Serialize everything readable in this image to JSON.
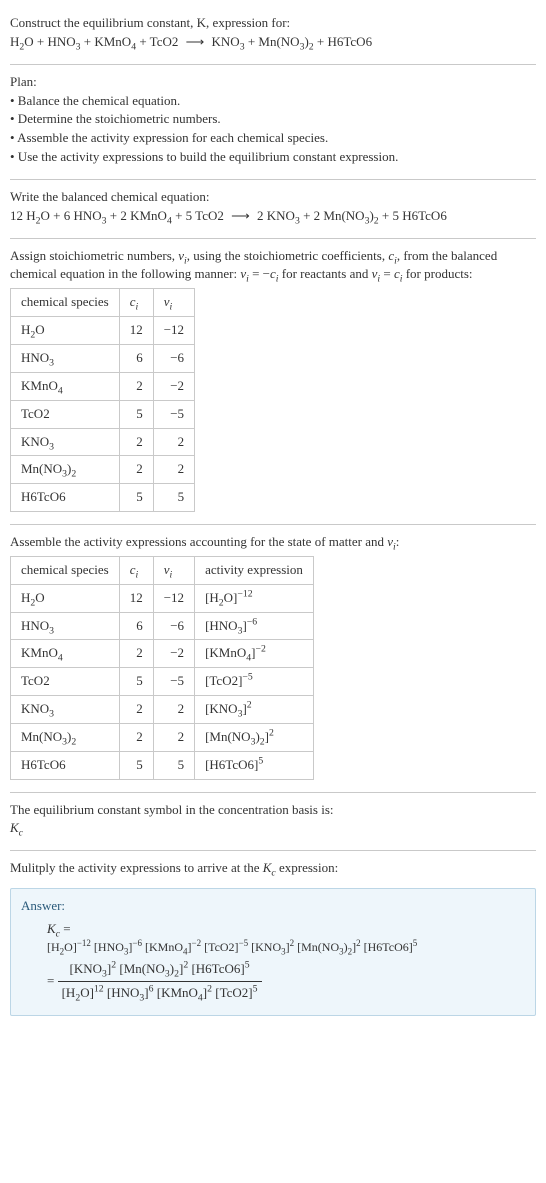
{
  "header": {
    "line1": "Construct the equilibrium constant, K, expression for:",
    "equation": "H₂O + HNO₃ + KMnO₄ + TcO2 ⟶ KNO₃ + Mn(NO₃)₂ + H6TcO6"
  },
  "plan": {
    "title": "Plan:",
    "items": [
      "• Balance the chemical equation.",
      "• Determine the stoichiometric numbers.",
      "• Assemble the activity expression for each chemical species.",
      "• Use the activity expressions to build the equilibrium constant expression."
    ]
  },
  "balanced": {
    "title": "Write the balanced chemical equation:",
    "equation": "12 H₂O + 6 HNO₃ + 2 KMnO₄ + 5 TcO2 ⟶ 2 KNO₃ + 2 Mn(NO₃)₂ + 5 H6TcO6"
  },
  "assign": {
    "title_prefix": "Assign stoichiometric numbers, νᵢ, using the stoichiometric coefficients, cᵢ, from the balanced chemical equation in the following manner: νᵢ = −cᵢ for reactants and νᵢ = cᵢ for products:"
  },
  "table1": {
    "headers": [
      "chemical species",
      "cᵢ",
      "νᵢ"
    ],
    "rows": [
      {
        "species": "H₂O",
        "c": "12",
        "v": "−12"
      },
      {
        "species": "HNO₃",
        "c": "6",
        "v": "−6"
      },
      {
        "species": "KMnO₄",
        "c": "2",
        "v": "−2"
      },
      {
        "species": "TcO2",
        "c": "5",
        "v": "−5"
      },
      {
        "species": "KNO₃",
        "c": "2",
        "v": "2"
      },
      {
        "species": "Mn(NO₃)₂",
        "c": "2",
        "v": "2"
      },
      {
        "species": "H6TcO6",
        "c": "5",
        "v": "5"
      }
    ]
  },
  "activity_intro": "Assemble the activity expressions accounting for the state of matter and νᵢ:",
  "table2": {
    "headers": [
      "chemical species",
      "cᵢ",
      "νᵢ",
      "activity expression"
    ],
    "rows": [
      {
        "species": "H₂O",
        "c": "12",
        "v": "−12",
        "act_base": "[H₂O]",
        "act_exp": "−12"
      },
      {
        "species": "HNO₃",
        "c": "6",
        "v": "−6",
        "act_base": "[HNO₃]",
        "act_exp": "−6"
      },
      {
        "species": "KMnO₄",
        "c": "2",
        "v": "−2",
        "act_base": "[KMnO₄]",
        "act_exp": "−2"
      },
      {
        "species": "TcO2",
        "c": "5",
        "v": "−5",
        "act_base": "[TcO2]",
        "act_exp": "−5"
      },
      {
        "species": "KNO₃",
        "c": "2",
        "v": "2",
        "act_base": "[KNO₃]",
        "act_exp": "2"
      },
      {
        "species": "Mn(NO₃)₂",
        "c": "2",
        "v": "2",
        "act_base": "[Mn(NO₃)₂]",
        "act_exp": "2"
      },
      {
        "species": "H6TcO6",
        "c": "5",
        "v": "5",
        "act_base": "[H6TcO6]",
        "act_exp": "5"
      }
    ]
  },
  "symbol": {
    "line1": "The equilibrium constant symbol in the concentration basis is:",
    "line2": "K_c"
  },
  "multiply_line": "Mulitply the activity expressions to arrive at the K_c expression:",
  "answer": {
    "title": "Answer:",
    "kc_eq": "K_c =",
    "line1_terms": [
      {
        "b": "[H₂O]",
        "e": "−12"
      },
      {
        "b": "[HNO₃]",
        "e": "−6"
      },
      {
        "b": "[KMnO₄]",
        "e": "−2"
      },
      {
        "b": "[TcO2]",
        "e": "−5"
      },
      {
        "b": "[KNO₃]",
        "e": "2"
      },
      {
        "b": "[Mn(NO₃)₂]",
        "e": "2"
      },
      {
        "b": "[H6TcO6]",
        "e": "5"
      }
    ],
    "eq2_prefix": "=",
    "frac_num": [
      {
        "b": "[KNO₃]",
        "e": "2"
      },
      {
        "b": "[Mn(NO₃)₂]",
        "e": "2"
      },
      {
        "b": "[H6TcO6]",
        "e": "5"
      }
    ],
    "frac_den": [
      {
        "b": "[H₂O]",
        "e": "12"
      },
      {
        "b": "[HNO₃]",
        "e": "6"
      },
      {
        "b": "[KMnO₄]",
        "e": "2"
      },
      {
        "b": "[TcO2]",
        "e": "5"
      }
    ]
  }
}
